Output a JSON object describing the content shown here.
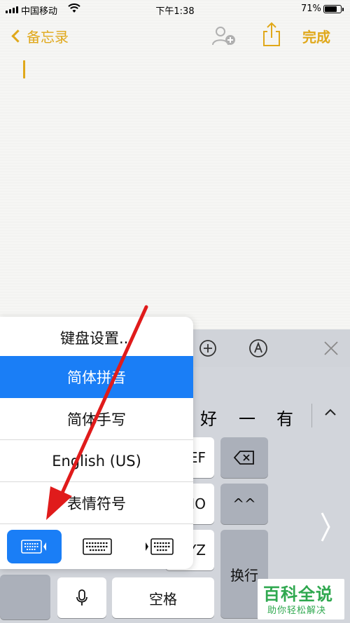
{
  "status_bar": {
    "carrier": "中国移动",
    "time": "下午1:38",
    "battery": "71%",
    "battery_level": 0.71
  },
  "nav": {
    "back_label": "备忘录",
    "done_label": "完成",
    "accent_color": "#e0a81a",
    "icons": [
      "chevron-left-icon",
      "add-person-icon",
      "share-icon"
    ]
  },
  "toolbar": {
    "icons": [
      "plus-circle-icon",
      "markup-pen-icon",
      "close-icon"
    ]
  },
  "candidates": {
    "items": [
      "好",
      "一",
      "有"
    ],
    "expand_icon": "chevron-up-icon"
  },
  "keys": {
    "key_def": "EF",
    "key_mno": "NO",
    "key_wxyz": "YZ",
    "return_label": "换行",
    "space_label": "空格",
    "caret_label": "^^"
  },
  "popup": {
    "items": [
      "键盘设置...",
      "简体拼音",
      "简体手写",
      "English (US)",
      "表情符号"
    ],
    "selected_index": 1,
    "selected_color": "#1a7ef6",
    "keyboard_modes": [
      "keyboard-left-icon",
      "keyboard-full-icon",
      "keyboard-right-icon"
    ]
  },
  "watermark": {
    "title": "百科全说",
    "subtitle": "助你轻松解决"
  },
  "annotation_color": "#e01b1b"
}
